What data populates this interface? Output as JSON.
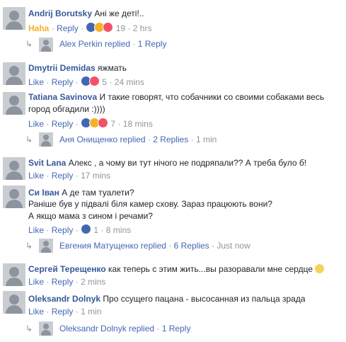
{
  "comments": [
    {
      "author": "Andrij Borutsky",
      "text": "Ані же деті!..",
      "reaction_label": "Haha",
      "reply": "Reply",
      "count": "19",
      "time": "2 hrs",
      "replies_row": {
        "author": "Alex Perkin replied",
        "count": "1 Reply"
      }
    },
    {
      "author": "Dmytrii Demidas",
      "text": "яжмать",
      "like": "Like",
      "reply": "Reply",
      "count": "5",
      "time": "24 mins"
    },
    {
      "author": "Tatiana Savinova",
      "text1": "И такие говорят, что собачники со своими собаками весь",
      "text2": "город обгадили :))))",
      "like": "Like",
      "reply": "Reply",
      "count": "7",
      "time": "18 mins",
      "replies_row": {
        "author": "Аня Онищенко replied",
        "count": "2 Replies",
        "time": "1 min"
      }
    },
    {
      "author": "Svit Lana",
      "text": "Алекс , а чому ви тут нічого не подряпали?? А треба було б!",
      "like": "Like",
      "reply": "Reply",
      "time": "17 mins"
    },
    {
      "author": "Си Іван",
      "text1": "А де там туалети?",
      "text2": "Раніше був у підвалі біля камер схову. Зараз працюють вони?",
      "text3": "А якщо мама з сином і речами?",
      "like": "Like",
      "reply": "Reply",
      "count": "1",
      "time": "8 mins",
      "replies_row": {
        "author": "Евгения Матущенко replied",
        "count": "6 Replies",
        "time": "Just now"
      }
    },
    {
      "author": "Сергей Терещенко",
      "text": "как теперь с этим жить...вы разоравали мне сердце",
      "like": "Like",
      "reply": "Reply",
      "time": "2 mins"
    },
    {
      "author": "Oleksandr Dolnyk",
      "text": "Про ссущего пацана - высосанная из пальца зрада",
      "like": "Like",
      "reply": "Reply",
      "time": "1 min",
      "replies_row": {
        "author": "Oleksandr Dolnyk replied",
        "count": "1 Reply"
      }
    }
  ],
  "separator": "·",
  "icons": {
    "reply_arrow": "reply-arrow-icon",
    "emoji": "slightly-smiling-face-icon"
  }
}
